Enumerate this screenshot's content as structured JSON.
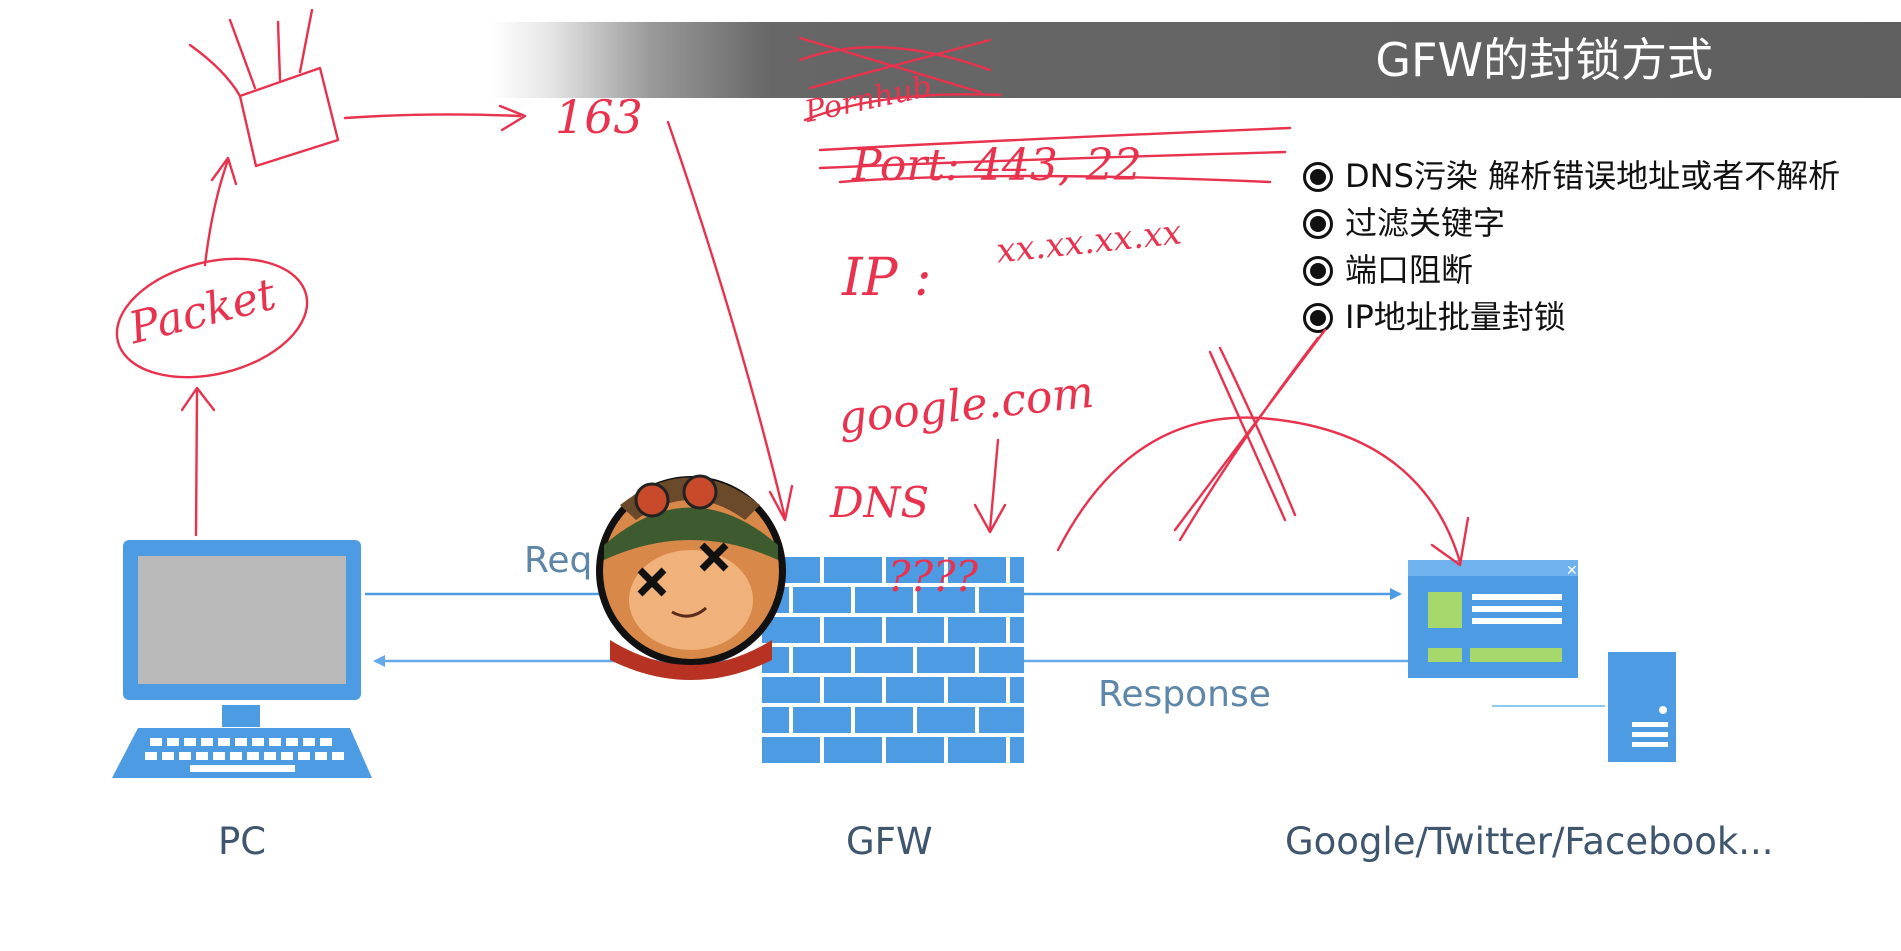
{
  "slide": {
    "title": "GFW的封锁方式",
    "bullets": [
      "DNS污染 解析错误地址或者不解析",
      "过滤关键字",
      "端口阻断",
      "IP地址批量封锁"
    ]
  },
  "diagram": {
    "nodes": {
      "pc": "PC",
      "gfw": "GFW",
      "sites": "Google/Twitter/Facebook..."
    },
    "edges": {
      "request": "Req",
      "response": "Response"
    }
  },
  "annotations": {
    "packet": "Packet",
    "ip_163": "163",
    "pornhub": "Pornhub",
    "port": "Port: 443, 22",
    "ip": "IP :",
    "ip_pattern": "xx.xx.xx.xx",
    "google": "google.com",
    "dns": "DNS",
    "question_marks": "????"
  },
  "colors": {
    "diagram_blue": "#4d9be3",
    "annotation_red": "#e8324e",
    "title_bar": "#5f5f5f"
  }
}
